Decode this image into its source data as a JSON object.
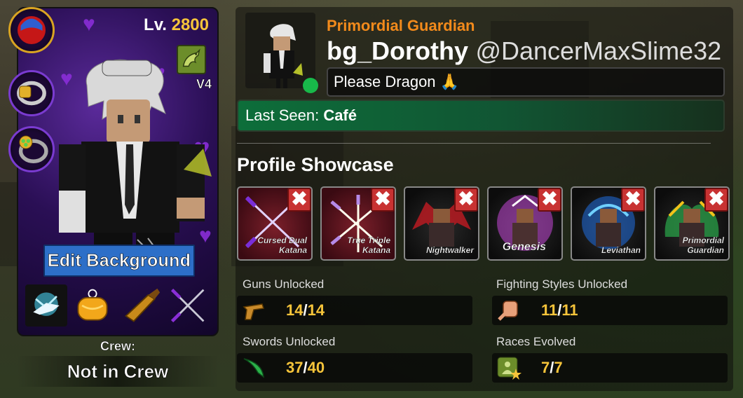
{
  "player": {
    "level_prefix": "Lv.",
    "level": "2800",
    "race_tier": "V4",
    "title": "Primordial Guardian",
    "display_name": "bg_Dorothy",
    "username": "@DancerMaxSlime32",
    "bio": "Please Dragon 🙏",
    "last_seen_label": "Last Seen:",
    "last_seen_value": "Café",
    "online_color": "#18b94a"
  },
  "card": {
    "edit_background_label": "Edit Background",
    "crew_label": "Crew:",
    "crew_value": "Not in Crew",
    "items": [
      "fighting-style-icon",
      "devil-fruit-icon",
      "gun-icon",
      "sword-icon"
    ]
  },
  "showcase": {
    "title": "Profile Showcase",
    "items": [
      {
        "label": "Cursed Dual\nKatana"
      },
      {
        "label": "True Triple\nKatana"
      },
      {
        "label": "Nightwalker"
      },
      {
        "label": "Genesis"
      },
      {
        "label": "Leviathan"
      },
      {
        "label": "Primordial\nGuardian"
      }
    ],
    "remove_glyph": "✖"
  },
  "stats": {
    "guns": {
      "label": "Guns Unlocked",
      "have": "14",
      "total": "14"
    },
    "fighting_styles": {
      "label": "Fighting Styles Unlocked",
      "have": "11",
      "total": "11"
    },
    "swords": {
      "label": "Swords Unlocked",
      "have": "37",
      "total": "40"
    },
    "races": {
      "label": "Races Evolved",
      "have": "7",
      "total": "7"
    },
    "separator": "/"
  },
  "colors": {
    "accent_orange": "#f28a1b",
    "value_gold": "#f6c43a",
    "card_purple": "#5a2a9a",
    "remove_red": "#c83232",
    "edit_blue": "#2d6fc8"
  }
}
